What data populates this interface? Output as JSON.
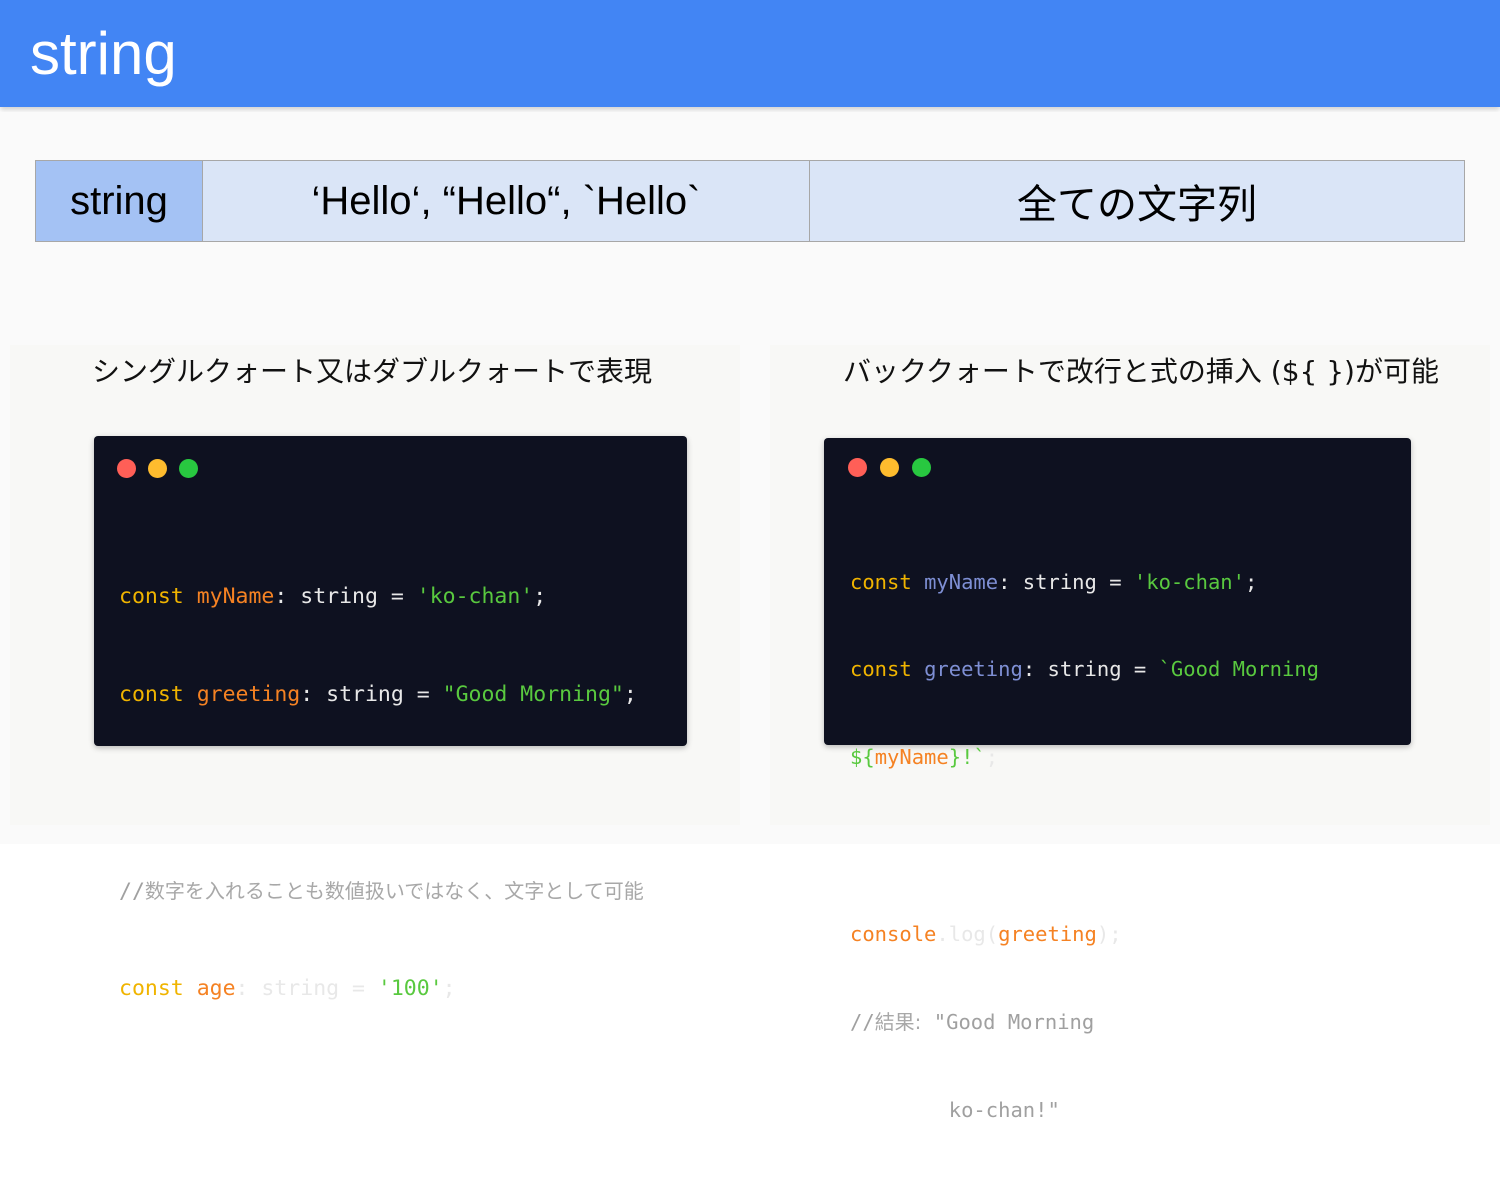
{
  "header": {
    "title": "string"
  },
  "type_table": {
    "type_name": "string",
    "examples": "‘Hello‘, “Hello“, `Hello`",
    "description": "全ての文字列"
  },
  "captions": {
    "left": "シングルクォート又はダブルクォートで表現",
    "right": "バッククォートで改行と式の挿入 (${ })が可能"
  },
  "code_left": {
    "line1": {
      "kw": "const",
      "var": "myName",
      "sep": ": string = ",
      "str": "'ko-chan'",
      "end": ";"
    },
    "line2": {
      "kw": "const",
      "var": "greeting",
      "sep": ": string = ",
      "str": "\"Good Morning\"",
      "end": ";"
    },
    "line3": {
      "comment_prefix": "//",
      "comment_text": "数字を入れることも数値扱いではなく、文字として可能"
    },
    "line4": {
      "kw": "const",
      "var": "age",
      "sep": ": string = ",
      "str": "'100'",
      "end": ";"
    }
  },
  "code_right": {
    "line1": {
      "kw": "const",
      "var": "myName",
      "sep": ": string = ",
      "str": "'ko-chan'",
      "end": ";"
    },
    "line2": {
      "kw": "const",
      "var": "greeting",
      "sep": ": string = ",
      "str": "`Good Morning"
    },
    "line3": {
      "str_a": "${",
      "var": "myName",
      "str_b": "}!`",
      "end": ";"
    },
    "line4": {
      "obj": "console",
      "dot": ".",
      "fn": "log(",
      "arg": "greeting",
      "end": ");"
    },
    "line5": {
      "comment_prefix": "//",
      "comment_label": "結果:",
      "comment_text": " \"Good Morning"
    },
    "line6": {
      "comment_text": "        ko-chan!\""
    }
  },
  "colors": {
    "header_bg": "#4285f4",
    "table_type_bg": "#a4c2f4",
    "table_cell_bg": "#dae5f7",
    "code_bg": "#0e1120",
    "keyword": "#f0b400",
    "variable": "#f58223",
    "variable_alt": "#7e8fd4",
    "string": "#59c93f",
    "comment": "#a0a0a0"
  }
}
